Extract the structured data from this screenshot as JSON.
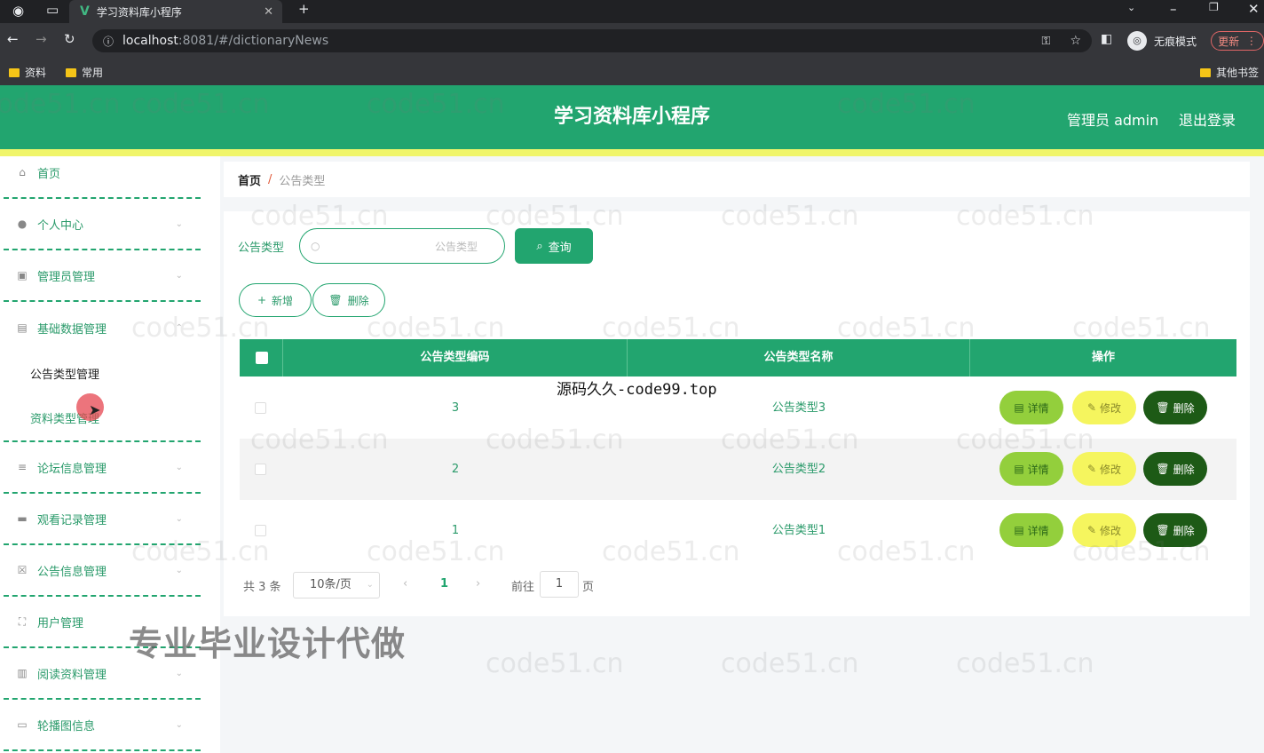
{
  "browser": {
    "tab_title": "学习资料库小程序",
    "tab_close": "✕",
    "new_tab": "+",
    "url_host": "localhost",
    "url_rest": ":8081/#/dictionaryNews",
    "incognito": "无痕模式",
    "update": "更新",
    "bookmarks": [
      "资料",
      "常用"
    ],
    "other_bookmarks": "其他书签"
  },
  "header": {
    "title": "学习资料库小程序",
    "admin": "管理员 admin",
    "logout": "退出登录"
  },
  "sidebar": {
    "items": [
      {
        "label": "首页",
        "icon": "home-icon"
      },
      {
        "label": "个人中心",
        "icon": "user-icon"
      },
      {
        "label": "管理员管理",
        "icon": "image-icon"
      },
      {
        "label": "基础数据管理",
        "icon": "chat-icon"
      },
      {
        "label": "论坛信息管理",
        "icon": "sliders-icon"
      },
      {
        "label": "观看记录管理",
        "icon": "briefcase-icon"
      },
      {
        "label": "公告信息管理",
        "icon": "checkbox-icon"
      },
      {
        "label": "用户管理",
        "icon": "fullscreen-icon"
      },
      {
        "label": "阅读资料管理",
        "icon": "document-icon"
      },
      {
        "label": "轮播图信息",
        "icon": "monitor-icon"
      }
    ],
    "subitems": [
      "公告类型管理",
      "资料类型管理"
    ]
  },
  "breadcrumb": {
    "home": "首页",
    "sep": "/",
    "current": "公告类型"
  },
  "search": {
    "label": "公告类型",
    "placeholder": "公告类型",
    "button": "查询"
  },
  "actions": {
    "add": "新增",
    "delete": "删除"
  },
  "table": {
    "headers": [
      "公告类型编码",
      "公告类型名称",
      "操作"
    ],
    "rows": [
      {
        "code": "3",
        "name": "公告类型3"
      },
      {
        "code": "2",
        "name": "公告类型2"
      },
      {
        "code": "1",
        "name": "公告类型1"
      }
    ],
    "row_actions": {
      "detail": "详情",
      "edit": "修改",
      "delete": "删除"
    }
  },
  "pagination": {
    "total": "共 3 条",
    "page_size": "10条/页",
    "current": "1",
    "goto": "前往",
    "goto_value": "1",
    "page_unit": "页"
  },
  "overlays": {
    "source_text": "源码久久-code99.top",
    "promo_text": "专业毕业设计代做",
    "watermark": "code51.cn"
  },
  "colors": {
    "primary": "#22a56f",
    "stripe": "#f0f56a",
    "detail": "#93cf3c",
    "edit": "#f5f55e",
    "delete": "#1d5a16"
  }
}
